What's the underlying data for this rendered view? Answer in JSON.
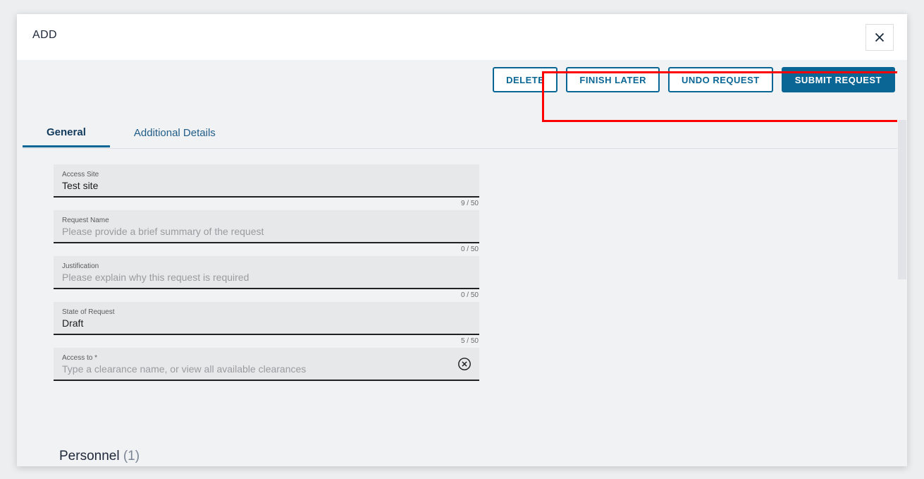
{
  "dialog": {
    "title": "ADD",
    "close_icon": "close-icon"
  },
  "actions": {
    "buttons": [
      {
        "label": "DELETE",
        "style": "outline",
        "name": "delete-button"
      },
      {
        "label": "FINISH LATER",
        "style": "outline",
        "name": "finish-later-button"
      },
      {
        "label": "UNDO REQUEST",
        "style": "outline",
        "name": "undo-request-button"
      },
      {
        "label": "SUBMIT REQUEST",
        "style": "primary",
        "name": "submit-request-button"
      }
    ],
    "highlight_color": "#ff0000"
  },
  "tabs": [
    {
      "label": "General",
      "active": true
    },
    {
      "label": "Additional Details",
      "active": false
    }
  ],
  "form": {
    "fields": [
      {
        "label": "Access Site",
        "value": "Test site",
        "placeholder": "",
        "counter": "9 / 50",
        "is_placeholder": false
      },
      {
        "label": "Request Name",
        "value": "",
        "placeholder": "Please provide a brief summary of the request",
        "counter": "0 / 50",
        "is_placeholder": true
      },
      {
        "label": "Justification",
        "value": "",
        "placeholder": "Please explain why this request is required",
        "counter": "0 / 50",
        "is_placeholder": true
      },
      {
        "label": "State of Request",
        "value": "Draft",
        "placeholder": "",
        "counter": "5 / 50",
        "is_placeholder": false
      },
      {
        "label": "Access to *",
        "value": "",
        "placeholder": "Type a clearance name, or view all available clearances",
        "counter": "",
        "is_placeholder": true,
        "clear_icon": "clear-circle-x-icon"
      }
    ]
  },
  "personnel": {
    "label": "Personnel",
    "count": "(1)"
  },
  "colors": {
    "accent": "#0a6694",
    "page_background": "#f1f2f4",
    "field_background": "#e7e8ea",
    "highlight": "#ff0000"
  }
}
